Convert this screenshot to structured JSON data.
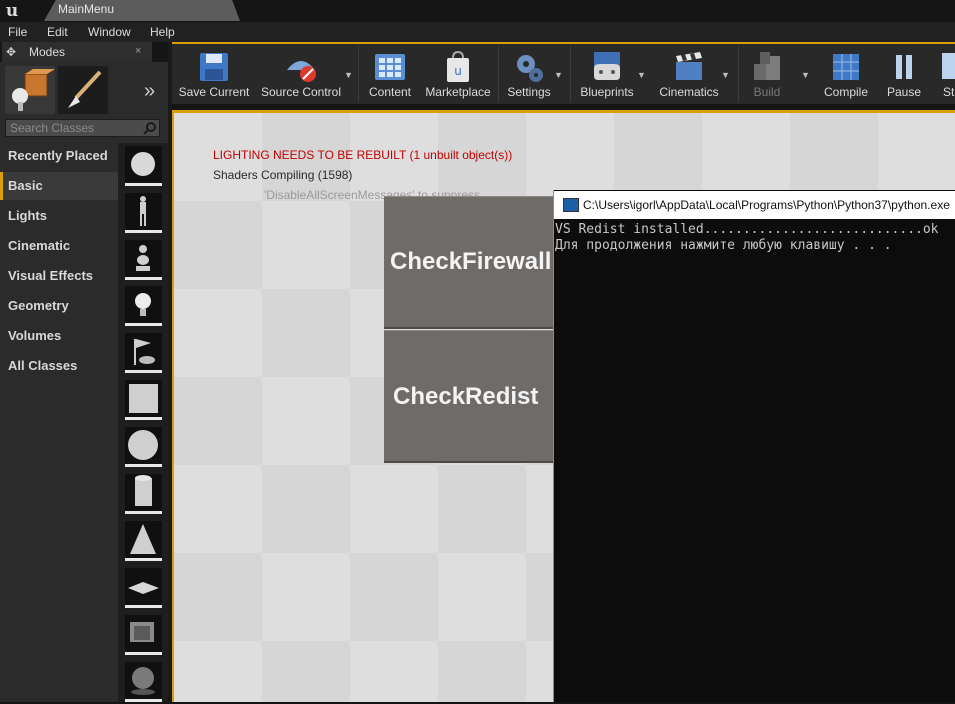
{
  "window": {
    "title": "MainMenu",
    "logo_glyph": "u"
  },
  "menu": [
    "File",
    "Edit",
    "Window",
    "Help"
  ],
  "modes": {
    "title": "Modes",
    "close_glyph": "×",
    "more_glyph": "»",
    "search_placeholder": "Search Classes",
    "categories": [
      "Recently Placed",
      "Basic",
      "Lights",
      "Cinematic",
      "Visual Effects",
      "Geometry",
      "Volumes",
      "All Classes"
    ],
    "active_category": "Basic",
    "thumbnails": [
      "sphere-icon",
      "mannequin-icon",
      "player-start-icon",
      "point-light-icon",
      "flag-icon",
      "cube-icon",
      "sphere-icon",
      "cylinder-icon",
      "cone-icon",
      "plane-icon",
      "box-trigger-icon",
      "sphere-trigger-icon"
    ]
  },
  "toolbar": {
    "items": [
      "Save Current",
      "Source Control",
      "Content",
      "Marketplace",
      "Settings",
      "Blueprints",
      "Cinematics",
      "Build",
      "Compile",
      "Pause",
      "St"
    ]
  },
  "viewport": {
    "lighting_msg": "LIGHTING NEEDS TO BE REBUILT (1 unbuilt object(s))",
    "shaders_msg": "Shaders Compiling (1598)",
    "suppress_msg": "'DisableAllScreenMessages' to suppress",
    "buttons": [
      "CheckFirewall",
      "CheckRedist"
    ]
  },
  "console": {
    "title": "C:\\Users\\igorl\\AppData\\Local\\Programs\\Python\\Python37\\python.exe",
    "lines": [
      "VS Redist installed............................ok",
      "Для продолжения нажмите любую клавишу . . ."
    ]
  },
  "colors": {
    "accent": "#d8a000",
    "warning": "#c40000",
    "console_bg": "#0c0c0c"
  }
}
